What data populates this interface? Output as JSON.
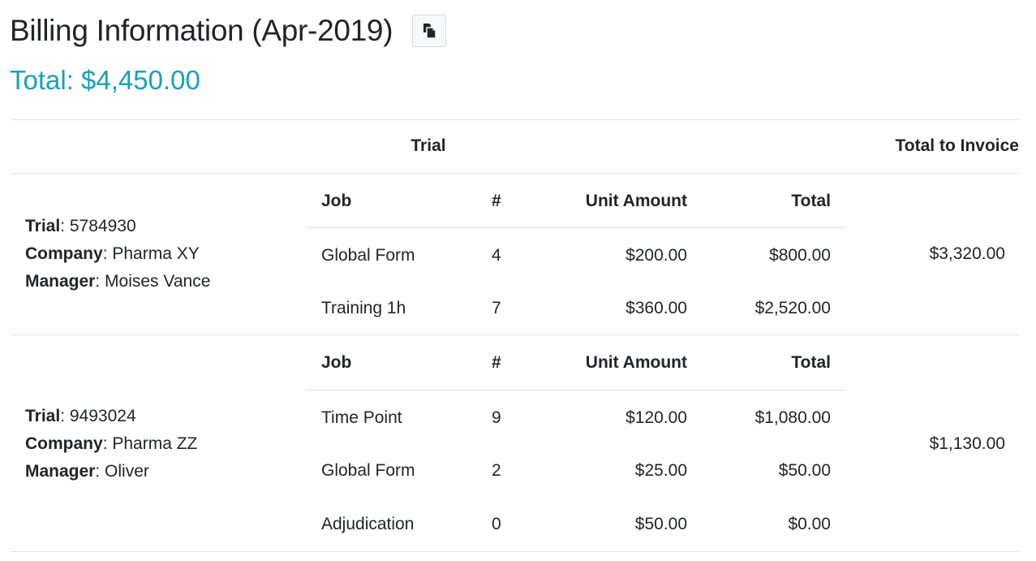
{
  "header": {
    "title": "Billing Information (Apr-2019)",
    "copy_icon": "copy-icon",
    "total": "Total: $4,450.00"
  },
  "colors": {
    "accent": "#17a2b8",
    "divider": "#dee2e6"
  },
  "table": {
    "col_trial": "Trial",
    "col_total_to_invoice": "Total to Invoice",
    "sub_headers": {
      "job": "Job",
      "num": "#",
      "unit": "Unit Amount",
      "total": "Total"
    },
    "labels": {
      "trial": "Trial",
      "company": "Company",
      "manager": "Manager"
    },
    "rows": [
      {
        "trial": "5784930",
        "company": "Pharma XY",
        "manager": "Moises Vance",
        "total_to_invoice": "$3,320.00",
        "jobs": [
          {
            "job": "Global Form",
            "num": "4",
            "unit": "$200.00",
            "total": "$800.00"
          },
          {
            "job": "Training 1h",
            "num": "7",
            "unit": "$360.00",
            "total": "$2,520.00"
          }
        ]
      },
      {
        "trial": "9493024",
        "company": "Pharma ZZ",
        "manager": "Oliver",
        "total_to_invoice": "$1,130.00",
        "jobs": [
          {
            "job": "Time Point",
            "num": "9",
            "unit": "$120.00",
            "total": "$1,080.00"
          },
          {
            "job": "Global Form",
            "num": "2",
            "unit": "$25.00",
            "total": "$50.00"
          },
          {
            "job": "Adjudication",
            "num": "0",
            "unit": "$50.00",
            "total": "$0.00"
          }
        ]
      }
    ]
  }
}
